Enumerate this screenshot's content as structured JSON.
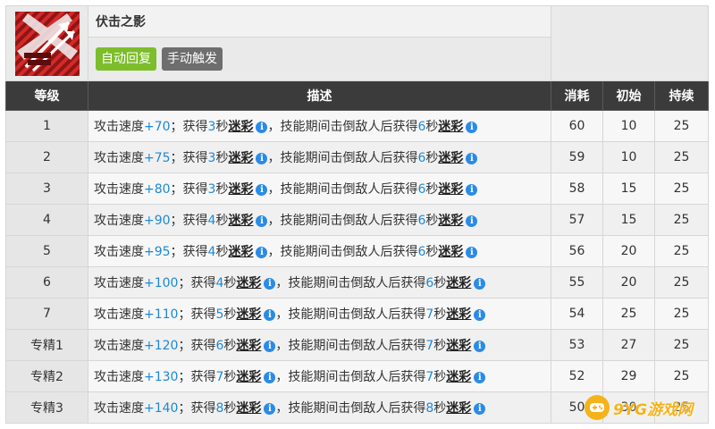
{
  "skill": {
    "name": "伏击之影",
    "recovery_tag": "自动回复",
    "trigger_tag": "手动触发",
    "icon": "ambush-shadow-skill-icon"
  },
  "table": {
    "headers": {
      "level": "等级",
      "desc": "描述",
      "cost": "消耗",
      "initial": "初始",
      "duration": "持续"
    },
    "rows": [
      {
        "level": "1",
        "p1": "攻击速度",
        "v1": "+70",
        "p2": "；获得",
        "v2": "3",
        "p3": "秒",
        "k1": "迷彩",
        "p4": "，技能期间击倒敌人后获得",
        "v3": "6",
        "p5": "秒",
        "k2": "迷彩",
        "cost": "60",
        "initial": "10",
        "duration": "25"
      },
      {
        "level": "2",
        "p1": "攻击速度",
        "v1": "+75",
        "p2": "；获得",
        "v2": "3",
        "p3": "秒",
        "k1": "迷彩",
        "p4": "，技能期间击倒敌人后获得",
        "v3": "6",
        "p5": "秒",
        "k2": "迷彩",
        "cost": "59",
        "initial": "10",
        "duration": "25"
      },
      {
        "level": "3",
        "p1": "攻击速度",
        "v1": "+80",
        "p2": "；获得",
        "v2": "3",
        "p3": "秒",
        "k1": "迷彩",
        "p4": "，技能期间击倒敌人后获得",
        "v3": "6",
        "p5": "秒",
        "k2": "迷彩",
        "cost": "58",
        "initial": "15",
        "duration": "25"
      },
      {
        "level": "4",
        "p1": "攻击速度",
        "v1": "+90",
        "p2": "；获得",
        "v2": "4",
        "p3": "秒",
        "k1": "迷彩",
        "p4": "，技能期间击倒敌人后获得",
        "v3": "6",
        "p5": "秒",
        "k2": "迷彩",
        "cost": "57",
        "initial": "15",
        "duration": "25"
      },
      {
        "level": "5",
        "p1": "攻击速度",
        "v1": "+95",
        "p2": "；获得",
        "v2": "4",
        "p3": "秒",
        "k1": "迷彩",
        "p4": "，技能期间击倒敌人后获得",
        "v3": "6",
        "p5": "秒",
        "k2": "迷彩",
        "cost": "56",
        "initial": "20",
        "duration": "25"
      },
      {
        "level": "6",
        "p1": "攻击速度",
        "v1": "+100",
        "p2": "；获得",
        "v2": "4",
        "p3": "秒",
        "k1": "迷彩",
        "p4": "，技能期间击倒敌人后获得",
        "v3": "6",
        "p5": "秒",
        "k2": "迷彩",
        "cost": "55",
        "initial": "20",
        "duration": "25"
      },
      {
        "level": "7",
        "p1": "攻击速度",
        "v1": "+110",
        "p2": "；获得",
        "v2": "5",
        "p3": "秒",
        "k1": "迷彩",
        "p4": "，技能期间击倒敌人后获得",
        "v3": "7",
        "p5": "秒",
        "k2": "迷彩",
        "cost": "54",
        "initial": "25",
        "duration": "25"
      },
      {
        "level": "专精1",
        "p1": "攻击速度",
        "v1": "+120",
        "p2": "；获得",
        "v2": "6",
        "p3": "秒",
        "k1": "迷彩",
        "p4": "，技能期间击倒敌人后获得",
        "v3": "7",
        "p5": "秒",
        "k2": "迷彩",
        "cost": "53",
        "initial": "27",
        "duration": "25"
      },
      {
        "level": "专精2",
        "p1": "攻击速度",
        "v1": "+130",
        "p2": "；获得",
        "v2": "7",
        "p3": "秒",
        "k1": "迷彩",
        "p4": "，技能期间击倒敌人后获得",
        "v3": "7",
        "p5": "秒",
        "k2": "迷彩",
        "cost": "52",
        "initial": "29",
        "duration": "25"
      },
      {
        "level": "专精3",
        "p1": "攻击速度",
        "v1": "+140",
        "p2": "；获得",
        "v2": "8",
        "p3": "秒",
        "k1": "迷彩",
        "p4": "，技能期间击倒敌人后获得",
        "v3": "8",
        "p5": "秒",
        "k2": "迷彩",
        "cost": "50",
        "initial": "30",
        "duration": "25"
      }
    ]
  },
  "watermark": {
    "text": "9YG游戏网",
    "icon": "gamepad-icon"
  },
  "colors": {
    "accent_blue": "#1e88d6",
    "tag_green": "#7dbd2c",
    "tag_gray": "#6e6e6e",
    "header_dark": "#3b3b3b",
    "watermark": "#f5b31a"
  }
}
